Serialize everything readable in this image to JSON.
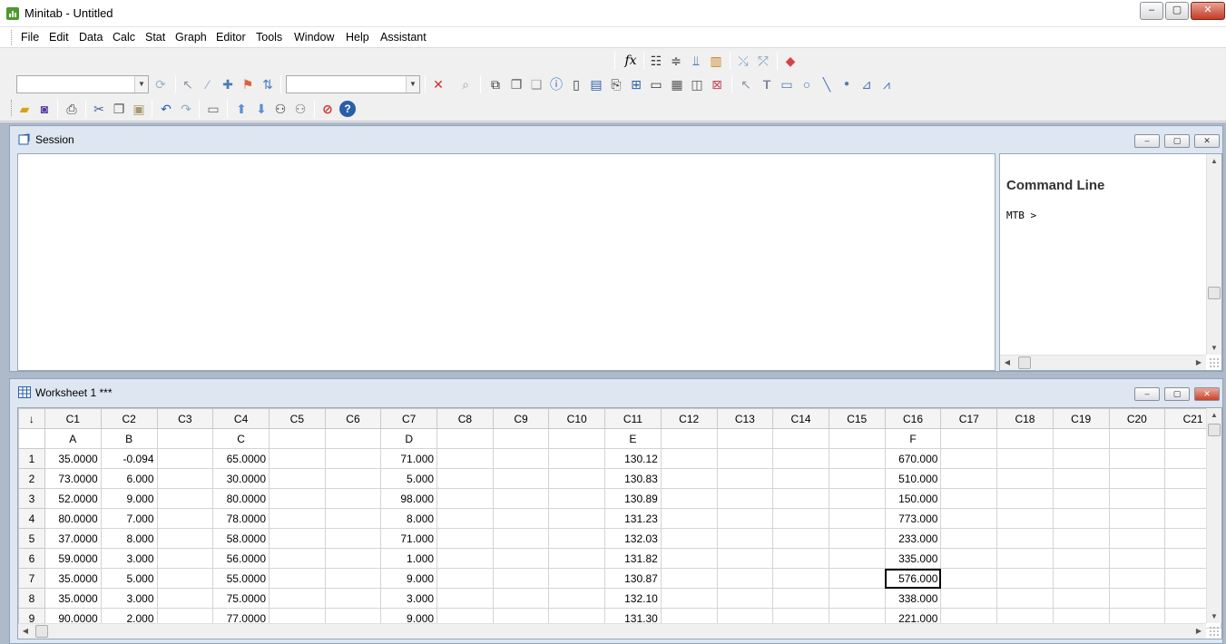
{
  "window": {
    "title": "Minitab - Untitled",
    "minimize": "–",
    "restore": "▢",
    "close": "✕"
  },
  "menu": [
    "File",
    "Edit",
    "Data",
    "Calc",
    "Stat",
    "Graph",
    "Editor",
    "Tools",
    "Window",
    "Help",
    "Assistant"
  ],
  "toolbar": {
    "fx": "fx",
    "icons": [
      "open-icon",
      "save-icon",
      "print-icon",
      "cut-icon",
      "copy-icon",
      "paste-icon",
      "undo-icon",
      "redo-icon",
      "window-icon",
      "row-up-icon",
      "row-down-icon",
      "find-icon",
      "replace-icon",
      "cancel-icon",
      "help-icon"
    ]
  },
  "session": {
    "title": "Session",
    "command_line_title": "Command Line",
    "prompt": "MTB >"
  },
  "worksheet": {
    "title": "Worksheet 1 ***",
    "corner": "↓",
    "columns": [
      "C1",
      "C2",
      "C3",
      "C4",
      "C5",
      "C6",
      "C7",
      "C8",
      "C9",
      "C10",
      "C11",
      "C12",
      "C13",
      "C14",
      "C15",
      "C16",
      "C17",
      "C18",
      "C19",
      "C20",
      "C21"
    ],
    "names": [
      "A",
      "B",
      "",
      "C",
      "",
      "",
      "D",
      "",
      "",
      "",
      "E",
      "",
      "",
      "",
      "",
      "F",
      "",
      "",
      "",
      "",
      ""
    ],
    "rows": [
      [
        "1",
        "35.0000",
        "-0.094",
        "",
        "65.0000",
        "",
        "",
        "71.000",
        "",
        "",
        "",
        "130.12",
        "",
        "",
        "",
        "",
        "670.000"
      ],
      [
        "2",
        "73.0000",
        "6.000",
        "",
        "30.0000",
        "",
        "",
        "5.000",
        "",
        "",
        "",
        "130.83",
        "",
        "",
        "",
        "",
        "510.000"
      ],
      [
        "3",
        "52.0000",
        "9.000",
        "",
        "80.0000",
        "",
        "",
        "98.000",
        "",
        "",
        "",
        "130.89",
        "",
        "",
        "",
        "",
        "150.000"
      ],
      [
        "4",
        "80.0000",
        "7.000",
        "",
        "78.0000",
        "",
        "",
        "8.000",
        "",
        "",
        "",
        "131.23",
        "",
        "",
        "",
        "",
        "773.000"
      ],
      [
        "5",
        "37.0000",
        "8.000",
        "",
        "58.0000",
        "",
        "",
        "71.000",
        "",
        "",
        "",
        "132.03",
        "",
        "",
        "",
        "",
        "233.000"
      ],
      [
        "6",
        "59.0000",
        "3.000",
        "",
        "56.0000",
        "",
        "",
        "1.000",
        "",
        "",
        "",
        "131.82",
        "",
        "",
        "",
        "",
        "335.000"
      ],
      [
        "7",
        "35.0000",
        "5.000",
        "",
        "55.0000",
        "",
        "",
        "9.000",
        "",
        "",
        "",
        "130.87",
        "",
        "",
        "",
        "",
        "576.000"
      ],
      [
        "8",
        "35.0000",
        "3.000",
        "",
        "75.0000",
        "",
        "",
        "3.000",
        "",
        "",
        "",
        "132.10",
        "",
        "",
        "",
        "",
        "338.000"
      ],
      [
        "9",
        "90.0000",
        "2.000",
        "",
        "77.0000",
        "",
        "",
        "9.000",
        "",
        "",
        "",
        "131.30",
        "",
        "",
        "",
        "",
        "221.000"
      ]
    ],
    "active_cell": {
      "row": 7,
      "col": "C16"
    }
  },
  "colors": {
    "mdi_bg": "#aeb9c9",
    "child_frame": "#dde6f1",
    "close_red": "#c63b25"
  }
}
